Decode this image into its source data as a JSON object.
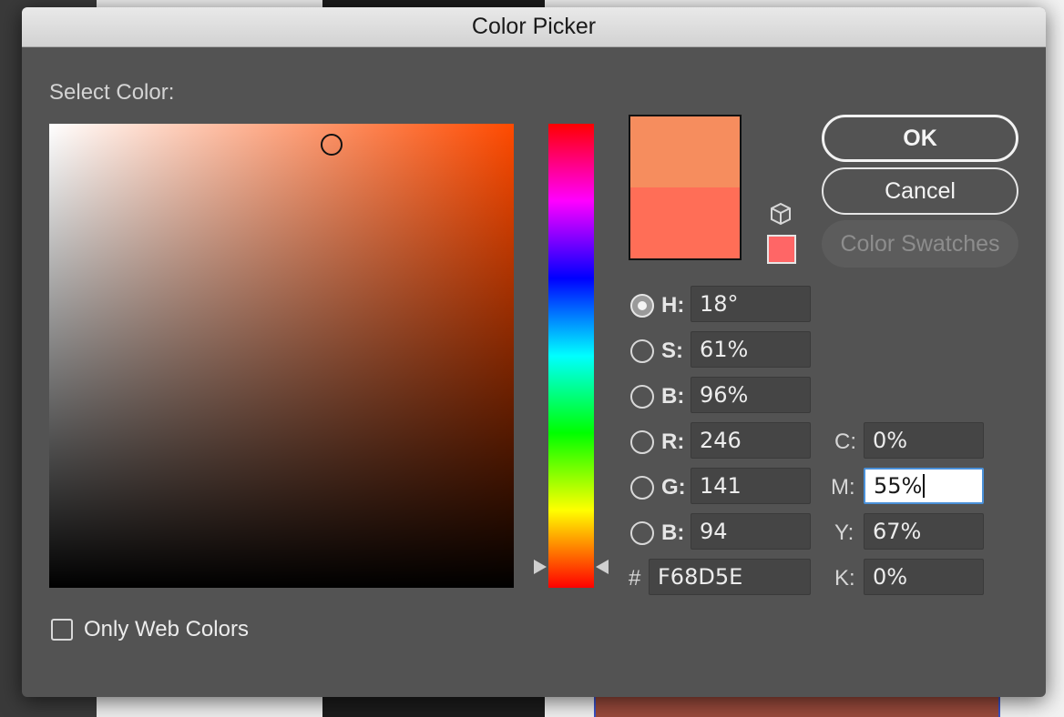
{
  "dialog": {
    "title": "Color Picker",
    "select_label": "Select Color:"
  },
  "colors": {
    "new_color": "#f68d5e",
    "old_color": "#ff6e57",
    "web_safe_swatch": "#ff6666",
    "field_hue": "#ff4a00"
  },
  "buttons": {
    "ok": "OK",
    "cancel": "Cancel",
    "swatches": "Color Swatches"
  },
  "hsb_rgb": [
    {
      "label": "H:",
      "value": "18°",
      "checked": true
    },
    {
      "label": "S:",
      "value": "61%",
      "checked": false
    },
    {
      "label": "B:",
      "value": "96%",
      "checked": false
    },
    {
      "label": "R:",
      "value": "246",
      "checked": false
    },
    {
      "label": "G:",
      "value": "141",
      "checked": false
    },
    {
      "label": "B:",
      "value": "94",
      "checked": false
    }
  ],
  "hex": {
    "label": "#",
    "value": "F68D5E"
  },
  "cmyk": [
    {
      "label": "C:",
      "value": "0%"
    },
    {
      "label": "M:",
      "value": "55%"
    },
    {
      "label": "Y:",
      "value": "67%"
    },
    {
      "label": "K:",
      "value": "0%"
    }
  ],
  "only_web_colors": {
    "label": "Only Web Colors",
    "checked": false
  },
  "icons": {
    "gamut_warning": "cube-icon",
    "field_marker": "circle-marker",
    "hue_slider": "triangle-arrows"
  }
}
